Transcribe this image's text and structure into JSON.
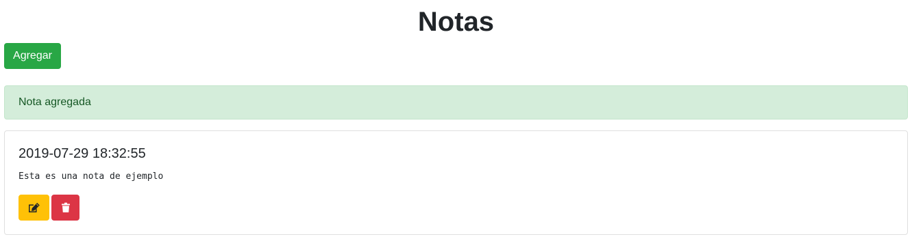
{
  "header": {
    "title": "Notas"
  },
  "toolbar": {
    "add_label": "Agregar"
  },
  "alert": {
    "message": "Nota agregada"
  },
  "notes": [
    {
      "title": "2019-07-29 18:32:55",
      "text": "Esta es una nota de ejemplo",
      "actions": [
        {
          "name": "edit",
          "icon": "edit-icon"
        },
        {
          "name": "delete",
          "icon": "trash-icon"
        }
      ]
    }
  ],
  "colors": {
    "add": "#28a745",
    "alert_bg": "#d4edda",
    "alert_text": "#155724",
    "edit": "#ffc107",
    "delete": "#dc3545"
  }
}
